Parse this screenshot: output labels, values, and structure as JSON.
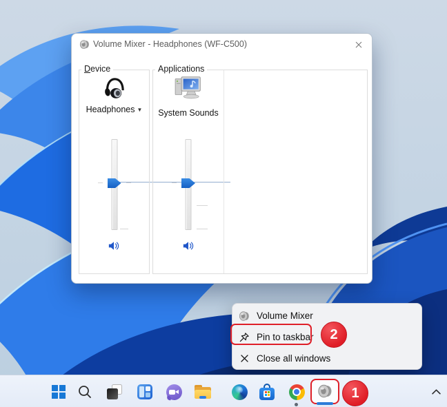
{
  "window": {
    "icon": "speaker-icon",
    "title": "Volume Mixer - Headphones (WF-C500)",
    "device_group": {
      "label_accel": "D",
      "label_rest": "evice",
      "selected_device": "Headphones",
      "dropdown_glyph": "▼"
    },
    "applications_group": {
      "label": "Applications",
      "apps": [
        {
          "name": "System Sounds",
          "icon": "system-sounds-icon"
        }
      ]
    }
  },
  "context_menu": {
    "items": [
      {
        "label": "Volume Mixer",
        "icon": "speaker-icon"
      },
      {
        "label": "Pin to taskbar",
        "icon": "pin-icon"
      },
      {
        "label": "Close all windows",
        "icon": "close-icon"
      }
    ]
  },
  "annotations": {
    "step_1": "1",
    "step_2": "2",
    "highlight_color": "#df1f28"
  },
  "taskbar": {
    "items": [
      "start",
      "search",
      "task-view",
      "widgets",
      "chat",
      "file-explorer",
      "edge",
      "microsoft-store",
      "chrome",
      "volume-mixer"
    ],
    "overflow": "show-hidden-icons"
  },
  "colors": {
    "slider_handle_blue": "#1f6fd0",
    "mute_speaker_blue": "#2057c9",
    "taskbar_bg": "#e9eff9",
    "menu_bg": "#f1f2f4",
    "wallpaper_sky": "#c6d6e4"
  }
}
